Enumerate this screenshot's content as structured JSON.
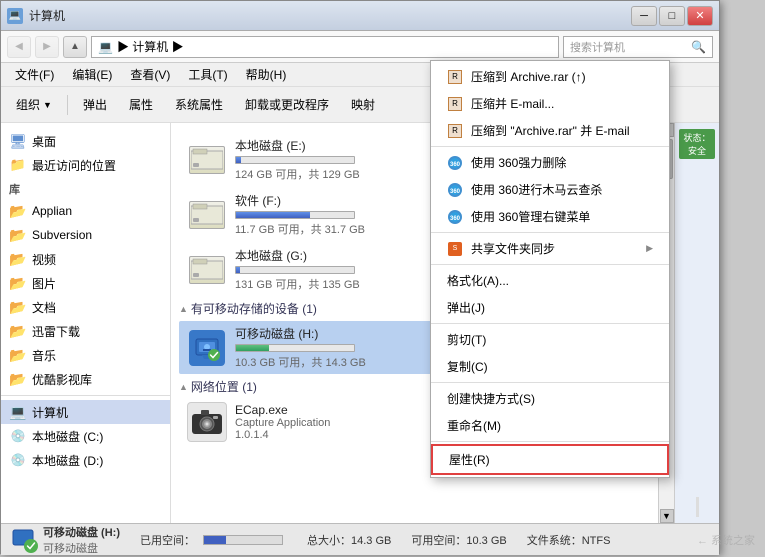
{
  "window": {
    "title": "计算机",
    "close_btn": "✕",
    "max_btn": "□",
    "min_btn": "─"
  },
  "address": {
    "path": "▶ 计算机 ▶",
    "search_placeholder": "搜索计算机"
  },
  "menubar": {
    "items": [
      "文件(F)",
      "编辑(E)",
      "查看(V)",
      "工具(T)",
      "帮助(H)"
    ]
  },
  "toolbar": {
    "items": [
      "组织 ▼",
      "弹出",
      "属性",
      "系统属性",
      "卸载或更改程序",
      "映射"
    ]
  },
  "sidebar": {
    "items": [
      {
        "label": "桌面",
        "type": "desktop"
      },
      {
        "label": "最近访问的位置",
        "type": "recent"
      },
      {
        "label": "库",
        "type": "section"
      },
      {
        "label": "Applian",
        "type": "folder"
      },
      {
        "label": "Subversion",
        "type": "folder"
      },
      {
        "label": "视频",
        "type": "folder"
      },
      {
        "label": "图片",
        "type": "folder"
      },
      {
        "label": "文档",
        "type": "folder"
      },
      {
        "label": "迅雷下载",
        "type": "folder"
      },
      {
        "label": "音乐",
        "type": "folder"
      },
      {
        "label": "优酷影视库",
        "type": "folder"
      },
      {
        "label": "计算机",
        "type": "computer"
      },
      {
        "label": "本地磁盘 (C:)",
        "type": "disk"
      },
      {
        "label": "本地磁盘 (D:)",
        "type": "disk"
      }
    ]
  },
  "drives": {
    "section1": "本地磁盘 (E:)",
    "drive_e": {
      "name": "本地磁盘 (E:)",
      "bar_pct": 4,
      "size_text": "124 GB 可用，共 129 GB"
    },
    "drive_f": {
      "name": "软件 (F:)",
      "bar_pct": 63,
      "size_text": "11.7 GB 可用，共 31.7 GB"
    },
    "drive_g": {
      "name": "本地磁盘 (G:)",
      "bar_pct": 3,
      "size_text": "131 GB 可用，共 135 GB"
    },
    "removable_section": "有可移动存储的设备 (1)",
    "drive_h": {
      "name": "可移动磁盘 (H:)",
      "bar_pct": 28,
      "size_text": "10.3 GB 可用，共 14.3 GB"
    },
    "network_section": "网络位置 (1)",
    "ecap": {
      "name": "ECap.exe",
      "desc": "Capture Application",
      "version": "1.0.1.4"
    }
  },
  "statusbar": {
    "drive_icon": "💾",
    "drive_label": "可移动磁盘 (H:)",
    "drive_sublabel": "可移动磁盘",
    "used_label": "已用空间：",
    "free_label": "可用空间：10.3 GB",
    "total_label": "总大小：14.3 GB",
    "fs_label": "文件系统：NTFS"
  },
  "info_panel": {
    "status": "状态：安全"
  },
  "context_menu": {
    "items": [
      {
        "label": "压缩到 Archive.rar (↑)",
        "icon": "📦",
        "type": "normal"
      },
      {
        "label": "压缩并 E-mail...",
        "icon": "📧",
        "type": "normal"
      },
      {
        "label": "压缩到 \"Archive.rar\" 并 E-mail",
        "icon": "📧",
        "type": "normal"
      },
      {
        "label": "使用 360强力删除",
        "icon": "🛡",
        "type": "360"
      },
      {
        "label": "使用 360进行木马云查杀",
        "icon": "🛡",
        "type": "360"
      },
      {
        "label": "使用 360管理右键菜单",
        "icon": "🛡",
        "type": "360"
      },
      {
        "label": "共享文件夹同步",
        "icon": "🟠",
        "type": "submenu"
      },
      {
        "label": "格式化(A)...",
        "type": "normal"
      },
      {
        "label": "弹出(J)",
        "type": "normal"
      },
      {
        "label": "剪切(T)",
        "type": "normal"
      },
      {
        "label": "复制(C)",
        "type": "normal"
      },
      {
        "label": "创建快捷方式(S)",
        "type": "normal"
      },
      {
        "label": "重命名(M)",
        "type": "normal"
      },
      {
        "label": "屋性(R)",
        "type": "highlighted"
      }
    ]
  },
  "watermark": {
    "text": "← 系统之家"
  }
}
